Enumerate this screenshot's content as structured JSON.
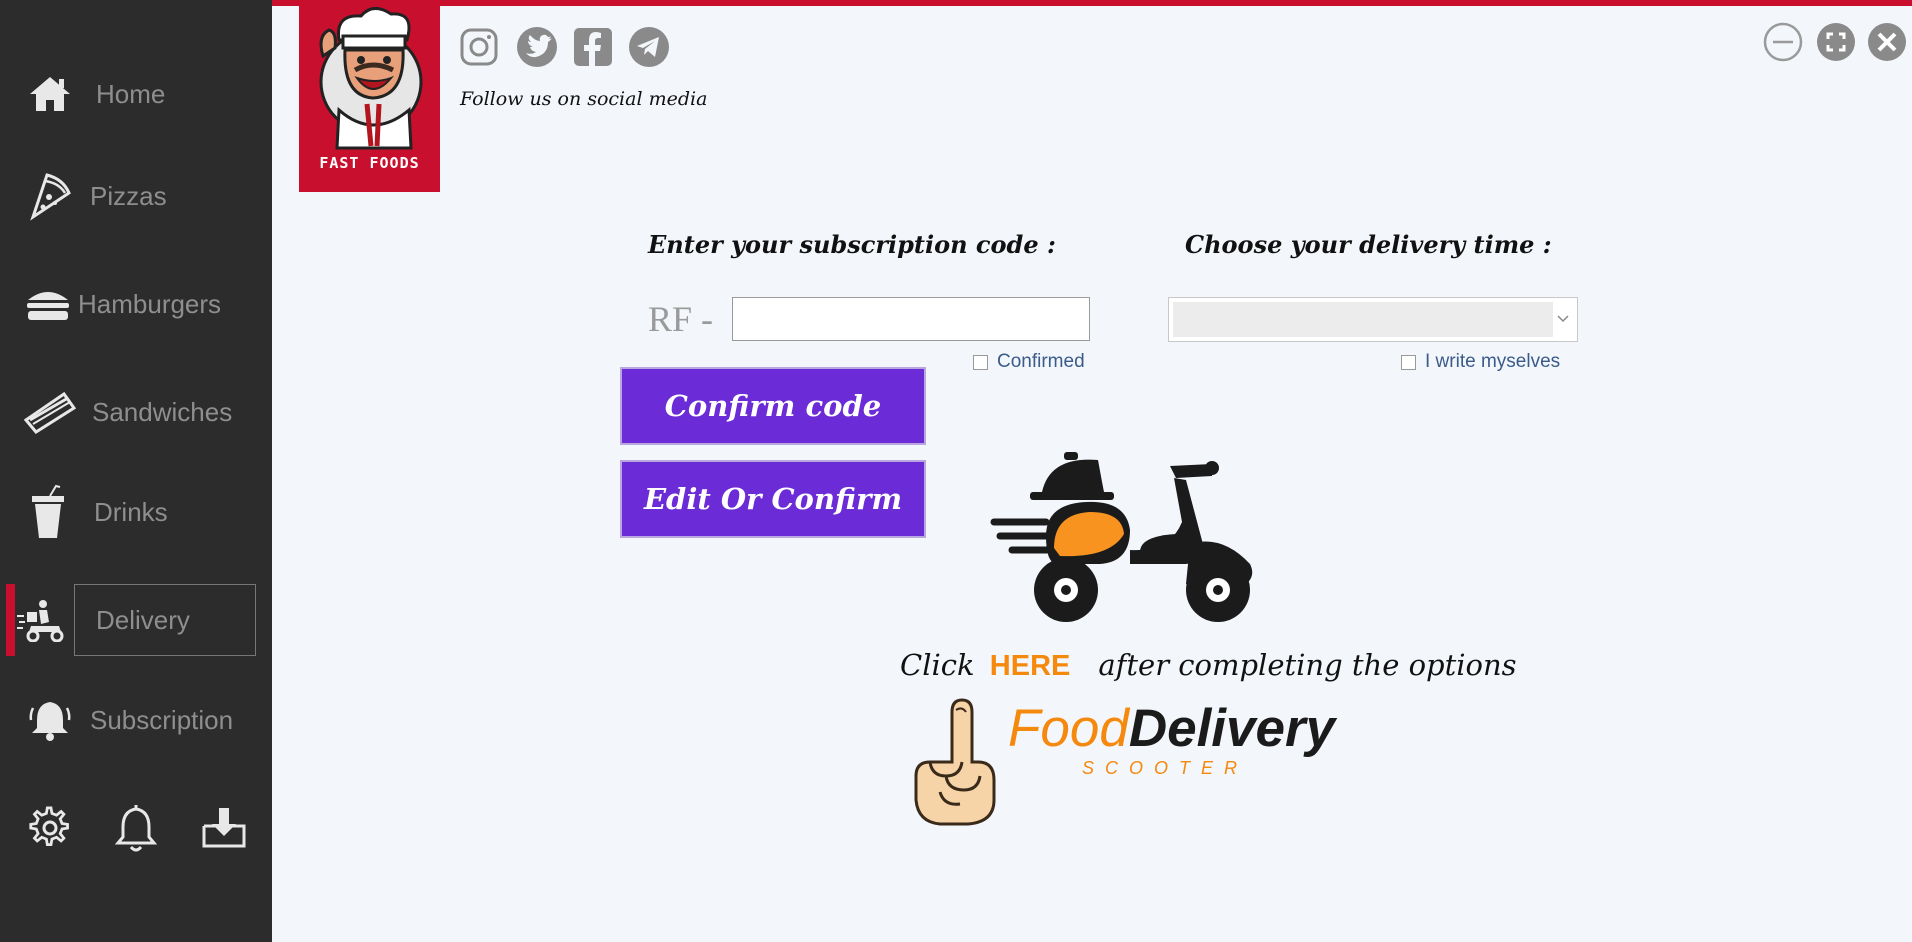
{
  "sidebar": {
    "items": [
      {
        "label": "Home",
        "icon": "home-icon"
      },
      {
        "label": "Pizzas",
        "icon": "pizza-icon"
      },
      {
        "label": "Hamburgers",
        "icon": "hamburger-icon"
      },
      {
        "label": "Sandwiches",
        "icon": "sandwich-icon"
      },
      {
        "label": "Drinks",
        "icon": "drink-icon"
      },
      {
        "label": "Delivery",
        "icon": "delivery-scooter-icon",
        "active": true
      },
      {
        "label": "Subscription",
        "icon": "alarm-bell-icon"
      }
    ],
    "bottom_icons": [
      "gear-icon",
      "bell-icon",
      "download-icon"
    ]
  },
  "logo": {
    "text": "FAST FOODS"
  },
  "social": {
    "icons": [
      "instagram-icon",
      "twitter-icon",
      "facebook-icon",
      "telegram-icon"
    ],
    "caption": "Follow us on social media"
  },
  "window_controls": [
    "minimize-icon",
    "maximize-icon",
    "close-icon"
  ],
  "subscription": {
    "heading": "Enter your subscription code :",
    "prefix": "RF -",
    "code_value": "",
    "confirmed_label": "Confirmed",
    "confirmed_checked": false
  },
  "delivery_time": {
    "heading": "Choose your delivery time :",
    "selected": "",
    "write_label": "I write myselves",
    "write_checked": false
  },
  "buttons": {
    "confirm_code": "Confirm code",
    "edit_confirm": "Edit Or Confirm"
  },
  "cta": {
    "click": "Click",
    "here": "HERE",
    "rest": "after completing the options"
  },
  "food_delivery_logo": {
    "food": "Food",
    "delivery": "Delivery",
    "sub": "SCOOTER"
  },
  "colors": {
    "sidebar": "#2c2c2c",
    "brand_red": "#c8102e",
    "button_purple": "#6b2bd6",
    "accent_orange": "#f5890d",
    "background": "#f3f6fb"
  }
}
